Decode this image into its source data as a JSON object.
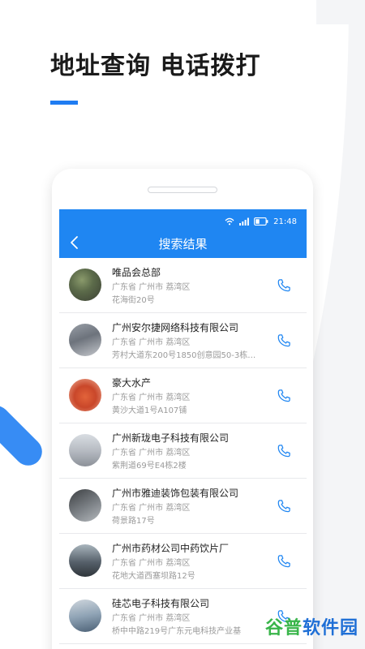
{
  "headline": "地址查询 电话拨打",
  "status": {
    "time": "21:48"
  },
  "appbar": {
    "title": "搜索结果"
  },
  "results": [
    {
      "name": "唯品会总部",
      "region": "广东省 广州市 荔湾区",
      "address": "花海街20号"
    },
    {
      "name": "广州安尔捷网络科技有限公司",
      "region": "广东省 广州市 荔湾区",
      "address": "芳村大道东200号1850创意园50-3栋…"
    },
    {
      "name": "豪大水产",
      "region": "广东省 广州市 荔湾区",
      "address": "黄沙大道1号A107铺"
    },
    {
      "name": "广州新珑电子科技有限公司",
      "region": "广东省 广州市 荔湾区",
      "address": "紫荆道69号E4栋2楼"
    },
    {
      "name": "广州市雅迪装饰包装有限公司",
      "region": "广东省 广州市 荔湾区",
      "address": "荷景路17号"
    },
    {
      "name": "广州市药材公司中药饮片厂",
      "region": "广东省 广州市 荔湾区",
      "address": "花地大道西塞坝路12号"
    },
    {
      "name": "硅芯电子科技有限公司",
      "region": "广东省 广州市 荔湾区",
      "address": "桥中中路219号广东元电科技产业基"
    }
  ],
  "watermark": {
    "part1": "谷普",
    "part2": "软件园"
  },
  "colors": {
    "accent": "#1f86f2",
    "headline_bar": "#1f7cf2"
  },
  "icons": {
    "back": "chevron-left-icon",
    "call": "phone-icon",
    "wifi": "wifi-icon",
    "signal": "signal-icon",
    "battery": "battery-icon"
  }
}
